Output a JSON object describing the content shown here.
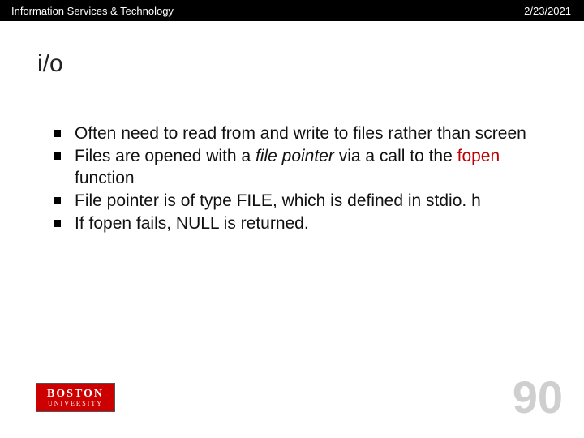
{
  "header": {
    "org": "Information Services & Technology",
    "date": "2/23/2021"
  },
  "title": "i/o",
  "bullets": {
    "b1": "Often need to read from and write to files rather than screen",
    "b2a": "Files are opened with a ",
    "b2b": "file pointer",
    "b2c": " via a call to the ",
    "b2d": "fopen",
    "b2e": " function",
    "b3": "File pointer is of type FILE, which is defined in stdio. h",
    "b4": "If fopen fails, NULL is returned."
  },
  "logo": {
    "line1": "BOSTON",
    "line2": "UNIVERSITY"
  },
  "page_number": "90"
}
